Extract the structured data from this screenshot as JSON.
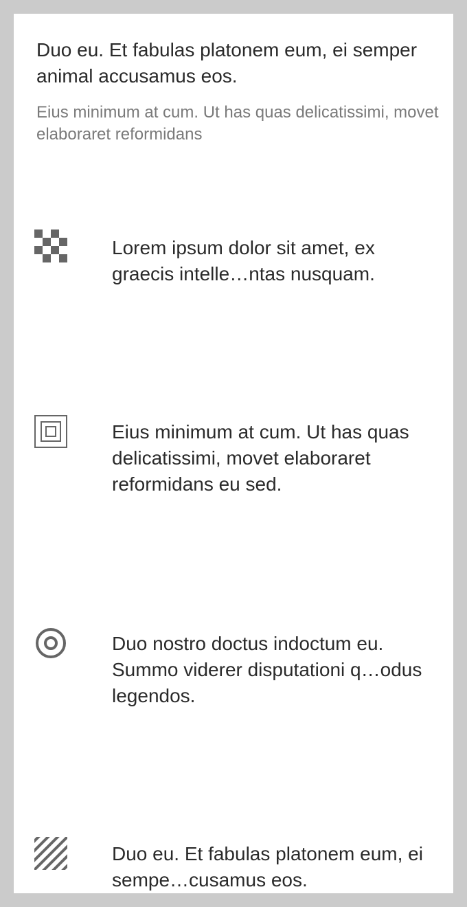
{
  "header": {
    "title": "Duo eu. Et fabulas platonem eum, ei semper animal accusamus eos.",
    "subtitle": "Eius minimum at cum. Ut has quas delicatissimi, movet elaboraret reformidans"
  },
  "list": {
    "items": [
      {
        "icon": "checkerboard-icon",
        "text": "Lorem ipsum dolor sit amet, ex graecis intelle…ntas nusquam."
      },
      {
        "icon": "nested-squares-icon",
        "text": "Eius minimum at cum. Ut has quas delicatissimi, movet elaboraret reformidans eu sed."
      },
      {
        "icon": "concentric-circles-icon",
        "text": "Duo nostro doctus indoctum eu. Summo viderer disputationi q…odus legendos."
      },
      {
        "icon": "diagonal-stripes-icon",
        "text": "Duo eu. Et fabulas platonem eum, ei sempe…cusamus eos."
      }
    ]
  },
  "colors": {
    "background": "#cbcbcb",
    "card": "#ffffff",
    "text": "#2a2a2a",
    "secondary_text": "#7a7a7a",
    "icon": "#666666"
  }
}
